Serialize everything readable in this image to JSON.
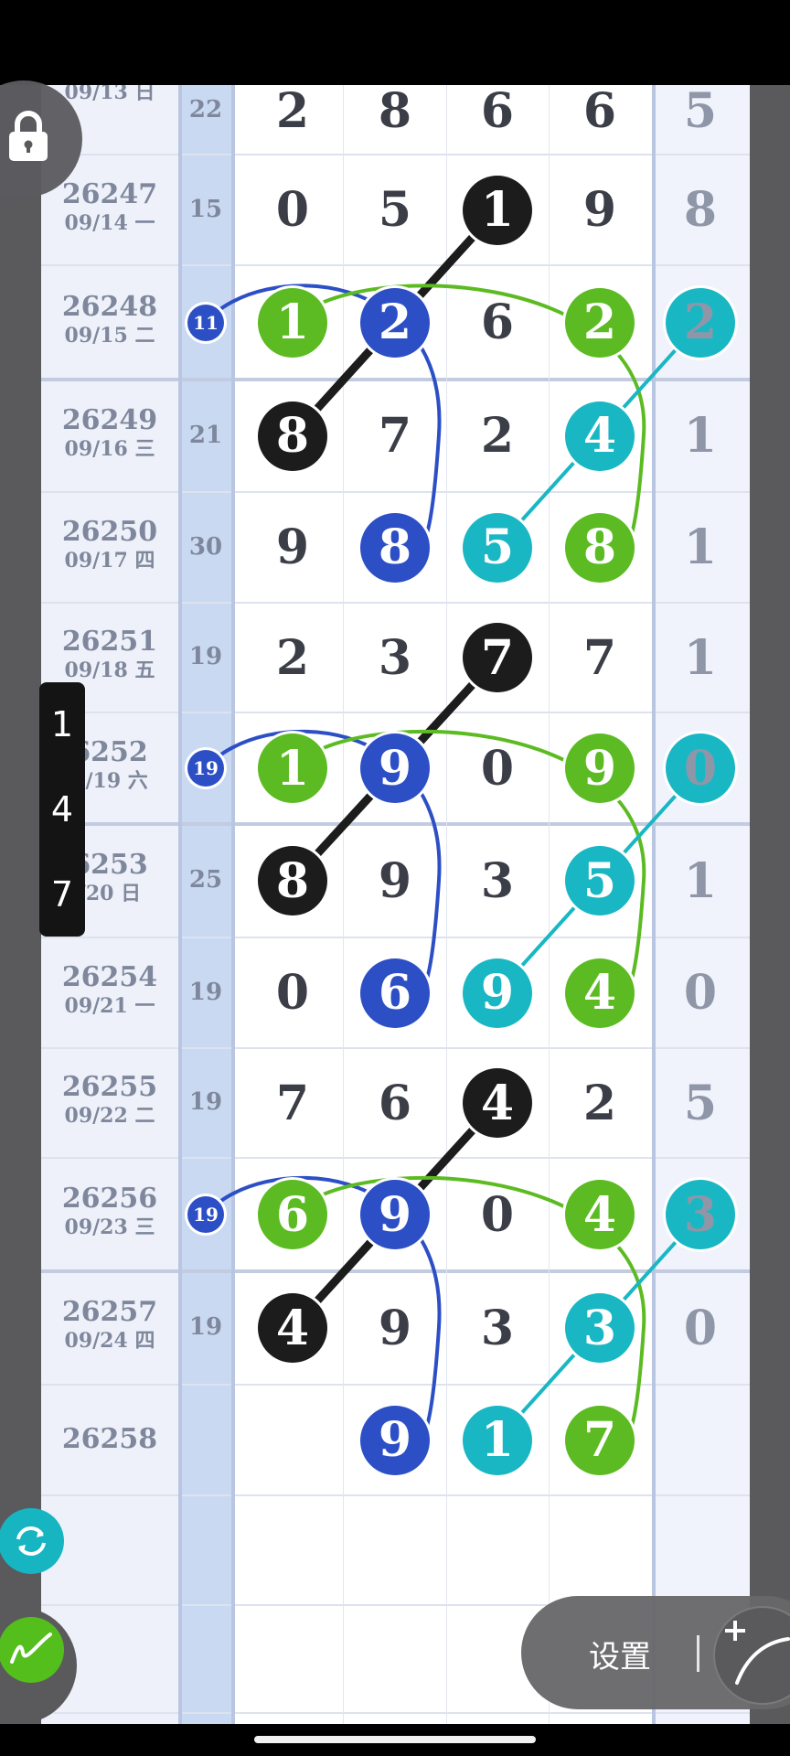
{
  "rows": [
    {
      "issue": "",
      "date": "09/13 日",
      "sum": "22",
      "digits": [
        "2",
        "8",
        "6",
        "6"
      ],
      "last": "5"
    },
    {
      "issue": "26247",
      "date": "09/14 一",
      "sum": "15",
      "digits": [
        "0",
        "5",
        "1",
        "9"
      ],
      "last": "8"
    },
    {
      "issue": "26248",
      "date": "09/15 二",
      "sum": "11",
      "digits": [
        "1",
        "2",
        "6",
        "2"
      ],
      "last": "2"
    },
    {
      "issue": "26249",
      "date": "09/16 三",
      "sum": "21",
      "digits": [
        "8",
        "7",
        "2",
        "4"
      ],
      "last": "1"
    },
    {
      "issue": "26250",
      "date": "09/17 四",
      "sum": "30",
      "digits": [
        "9",
        "8",
        "5",
        "8"
      ],
      "last": "1"
    },
    {
      "issue": "26251",
      "date": "09/18 五",
      "sum": "19",
      "digits": [
        "2",
        "3",
        "7",
        "7"
      ],
      "last": "1"
    },
    {
      "issue": "6252",
      "date": "9/19 六",
      "sum": "19",
      "digits": [
        "1",
        "9",
        "0",
        "9"
      ],
      "last": "0"
    },
    {
      "issue": "6253",
      "date": "/20 日",
      "sum": "25",
      "digits": [
        "8",
        "9",
        "3",
        "5"
      ],
      "last": "1"
    },
    {
      "issue": "26254",
      "date": "09/21 一",
      "sum": "19",
      "digits": [
        "0",
        "6",
        "9",
        "4"
      ],
      "last": "0"
    },
    {
      "issue": "26255",
      "date": "09/22 二",
      "sum": "19",
      "digits": [
        "7",
        "6",
        "4",
        "2"
      ],
      "last": "5"
    },
    {
      "issue": "26256",
      "date": "09/23 三",
      "sum": "19",
      "digits": [
        "6",
        "9",
        "0",
        "4"
      ],
      "last": "3"
    },
    {
      "issue": "26257",
      "date": "09/24 四",
      "sum": "19",
      "digits": [
        "4",
        "9",
        "3",
        "3"
      ],
      "last": "0"
    },
    {
      "issue": "26258",
      "date": "",
      "sum": "",
      "digits": [
        "",
        "9",
        "1",
        "7"
      ],
      "last": ""
    },
    {
      "issue": "",
      "date": "",
      "sum": "",
      "digits": [
        "",
        "",
        "",
        ""
      ],
      "last": ""
    },
    {
      "issue": "",
      "date": "",
      "sum": "",
      "digits": [
        "",
        "",
        "",
        ""
      ],
      "last": ""
    }
  ],
  "highlights": [
    {
      "row": 1,
      "col": 2,
      "color": "black"
    },
    {
      "row": 2,
      "col": 0,
      "color": "green"
    },
    {
      "row": 2,
      "col": 1,
      "color": "blue"
    },
    {
      "row": 2,
      "col": 3,
      "color": "green"
    },
    {
      "row": 2,
      "col": 4,
      "color": "teal"
    },
    {
      "row": 3,
      "col": 0,
      "color": "black"
    },
    {
      "row": 3,
      "col": 3,
      "color": "teal"
    },
    {
      "row": 4,
      "col": 1,
      "color": "blue"
    },
    {
      "row": 4,
      "col": 2,
      "color": "teal"
    },
    {
      "row": 4,
      "col": 3,
      "color": "green"
    },
    {
      "row": 5,
      "col": 2,
      "color": "black"
    },
    {
      "row": 6,
      "col": 0,
      "color": "green"
    },
    {
      "row": 6,
      "col": 1,
      "color": "blue"
    },
    {
      "row": 6,
      "col": 3,
      "color": "green"
    },
    {
      "row": 6,
      "col": 4,
      "color": "teal"
    },
    {
      "row": 7,
      "col": 0,
      "color": "black"
    },
    {
      "row": 7,
      "col": 3,
      "color": "teal"
    },
    {
      "row": 8,
      "col": 1,
      "color": "blue"
    },
    {
      "row": 8,
      "col": 2,
      "color": "teal"
    },
    {
      "row": 8,
      "col": 3,
      "color": "green"
    },
    {
      "row": 9,
      "col": 2,
      "color": "black"
    },
    {
      "row": 10,
      "col": 0,
      "color": "green"
    },
    {
      "row": 10,
      "col": 1,
      "color": "blue"
    },
    {
      "row": 10,
      "col": 3,
      "color": "green"
    },
    {
      "row": 10,
      "col": 4,
      "color": "teal"
    },
    {
      "row": 11,
      "col": 0,
      "color": "black"
    },
    {
      "row": 11,
      "col": 3,
      "color": "teal"
    },
    {
      "row": 12,
      "col": 1,
      "color": "blue"
    },
    {
      "row": 12,
      "col": 2,
      "color": "teal"
    },
    {
      "row": 12,
      "col": 3,
      "color": "green"
    }
  ],
  "sum_highlights": [
    2,
    6,
    10
  ],
  "connections": [
    {
      "color": "black",
      "type": "line",
      "from": [
        1,
        2
      ],
      "to": [
        3,
        0
      ]
    },
    {
      "color": "blue",
      "type": "curve",
      "from": [
        2,
        -1
      ],
      "to": [
        4,
        1
      ]
    },
    {
      "color": "green",
      "type": "curve",
      "from": [
        2,
        0
      ],
      "to": [
        4,
        3
      ]
    },
    {
      "color": "teal",
      "type": "line",
      "from": [
        2,
        4
      ],
      "to": [
        4,
        2
      ]
    },
    {
      "color": "black",
      "type": "line",
      "from": [
        5,
        2
      ],
      "to": [
        7,
        0
      ]
    },
    {
      "color": "blue",
      "type": "curve",
      "from": [
        6,
        -1
      ],
      "to": [
        8,
        1
      ]
    },
    {
      "color": "green",
      "type": "curve",
      "from": [
        6,
        0
      ],
      "to": [
        8,
        3
      ]
    },
    {
      "color": "teal",
      "type": "line",
      "from": [
        6,
        4
      ],
      "to": [
        8,
        2
      ]
    },
    {
      "color": "black",
      "type": "line",
      "from": [
        9,
        2
      ],
      "to": [
        11,
        0
      ]
    },
    {
      "color": "blue",
      "type": "curve",
      "from": [
        10,
        -1
      ],
      "to": [
        12,
        1
      ]
    },
    {
      "color": "green",
      "type": "curve",
      "from": [
        10,
        0
      ],
      "to": [
        12,
        3
      ]
    },
    {
      "color": "teal",
      "type": "line",
      "from": [
        10,
        4
      ],
      "to": [
        12,
        2
      ]
    }
  ],
  "colors": {
    "black": "#1c1c1c",
    "blue": "#2d4fc6",
    "green": "#5cbb22",
    "teal": "#19b7c4"
  },
  "thick_row_lines": [
    3,
    7,
    11
  ],
  "side_menu": [
    "1",
    "4",
    "7"
  ],
  "icons": {
    "lock": "lock-icon",
    "refresh": "refresh-icon",
    "pen": "pen-icon",
    "draw": "draw-line-icon"
  },
  "settings_label": "设置"
}
